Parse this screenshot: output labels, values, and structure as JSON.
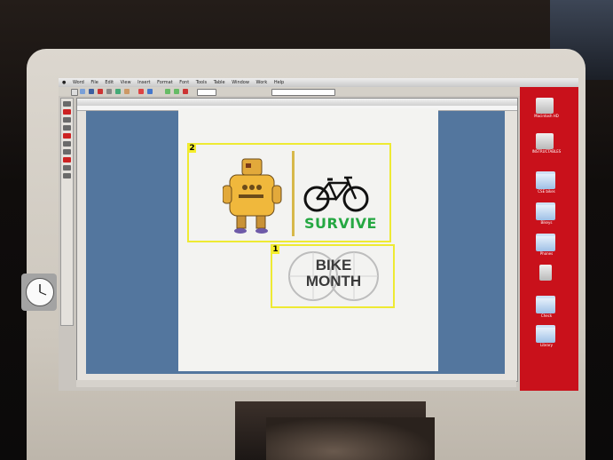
{
  "photo": {
    "subject": "iMac monitor displaying a layout application with two numbered annotation boxes",
    "annotation_color": "#f5ee2c",
    "desktop_color": "#c9111b",
    "pasteboard_color": "#53769e"
  },
  "menu_items": [
    "Word",
    "File",
    "Edit",
    "View",
    "Insert",
    "Format",
    "Font",
    "Tools",
    "Table",
    "Window",
    "Work",
    "Help"
  ],
  "desktop_icons": [
    {
      "label": "Macintosh HD",
      "type": "drive"
    },
    {
      "label": "INSTRUCTABLES",
      "type": "drive"
    },
    {
      "label": "CSE bikes",
      "type": "folder"
    },
    {
      "label": "Bikeys",
      "type": "folder"
    },
    {
      "label": "Phones",
      "type": "folder"
    },
    {
      "label": "",
      "type": "file"
    },
    {
      "label": "Check",
      "type": "folder"
    },
    {
      "label": "Library",
      "type": "folder"
    }
  ],
  "annotations": [
    {
      "number": "2",
      "content": "robot and bicycle artwork"
    },
    {
      "number": "1",
      "content": "bike month logo"
    }
  ],
  "artwork": {
    "survive_text": "SURVIVE",
    "bike_month_line1": "BIKE",
    "bike_month_line2": "MONTH"
  }
}
